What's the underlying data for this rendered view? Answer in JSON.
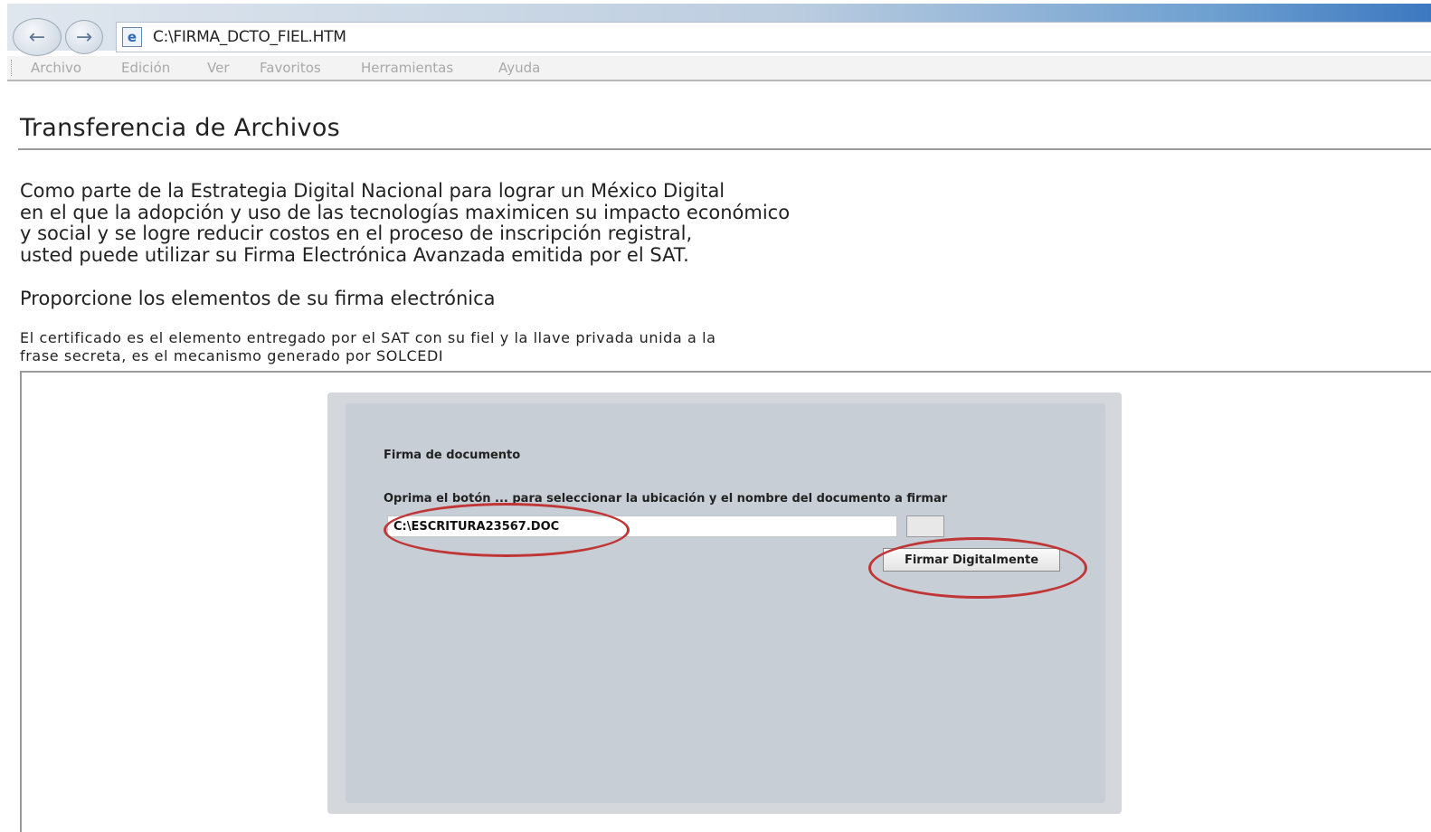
{
  "browser": {
    "address": "C:\\FIRMA_DCTO_FIEL.HTM",
    "menu": [
      "Archivo",
      "Edición",
      "Ver",
      "Favoritos",
      "Herramientas",
      "Ayuda"
    ]
  },
  "page": {
    "title": "Transferencia de Archivos",
    "intro_lines": [
      "Como parte de la Estrategia Digital Nacional para lograr un México Digital",
      "en el que la adopción y uso de las tecnologías maximicen su impacto económico",
      "y social y se logre reducir costos en el proceso de inscripción registral,",
      "usted puede utilizar su Firma Electrónica Avanzada emitida por el SAT."
    ],
    "subheading": "Proporcione los elementos de su firma electrónica",
    "note_lines": [
      "El certificado es el elemento entregado por el SAT con su fiel y la llave privada unida a la",
      "frase secreta, es el mecanismo generado por SOLCEDI"
    ]
  },
  "applet": {
    "title": "Firma de documento",
    "instruction": "Oprima el botón ... para seleccionar la ubicación y el nombre del documento a firmar",
    "file_value": "C:\\ESCRITURA23567.DOC",
    "sign_button": "Firmar Digitalmente"
  },
  "colors": {
    "annotation": "#c03535",
    "applet_bg": "#c7ced5"
  }
}
